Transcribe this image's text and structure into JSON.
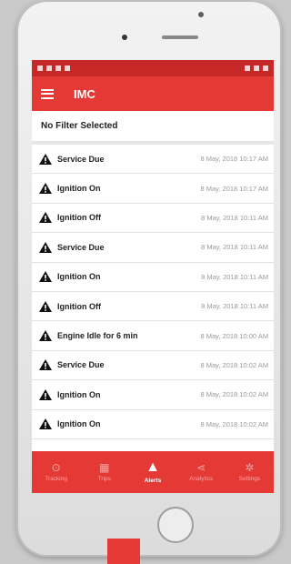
{
  "app": {
    "title": "IMC"
  },
  "filter": {
    "label": "No Filter Selected"
  },
  "alerts": [
    {
      "name": "Service Due",
      "time": "8 May, 2018 10:17 AM"
    },
    {
      "name": "Ignition On",
      "time": "8 May, 2018 10:17 AM"
    },
    {
      "name": "Ignition Off",
      "time": "8 May, 2018 10:11 AM"
    },
    {
      "name": "Service Due",
      "time": "8 May, 2018 10:11 AM"
    },
    {
      "name": "Ignition On",
      "time": "8 May, 2018 10:11 AM"
    },
    {
      "name": "Ignition Off",
      "time": "8 May, 2018 10:11 AM"
    },
    {
      "name": "Engine Idle for 6 min",
      "time": "8 May, 2018 10:00 AM"
    },
    {
      "name": "Service Due",
      "time": "8 May, 2018 10:02 AM"
    },
    {
      "name": "Ignition On",
      "time": "8 May, 2018 10:02 AM"
    },
    {
      "name": "Ignition On",
      "time": "8 May, 2018 10:02 AM"
    }
  ],
  "nav": [
    {
      "label": "Tracking",
      "icon": "location-pin-icon",
      "glyph": "⊙"
    },
    {
      "label": "Trips",
      "icon": "trips-icon",
      "glyph": "▦"
    },
    {
      "label": "Alerts",
      "icon": "warning-icon",
      "glyph": "▲"
    },
    {
      "label": "Analytics",
      "icon": "share-icon",
      "glyph": "⋖"
    },
    {
      "label": "Settings",
      "icon": "gear-icon",
      "glyph": "✲"
    }
  ],
  "colors": {
    "brand": "#e53935",
    "status_bar": "#c62828",
    "phone_marker": "#e53935"
  }
}
